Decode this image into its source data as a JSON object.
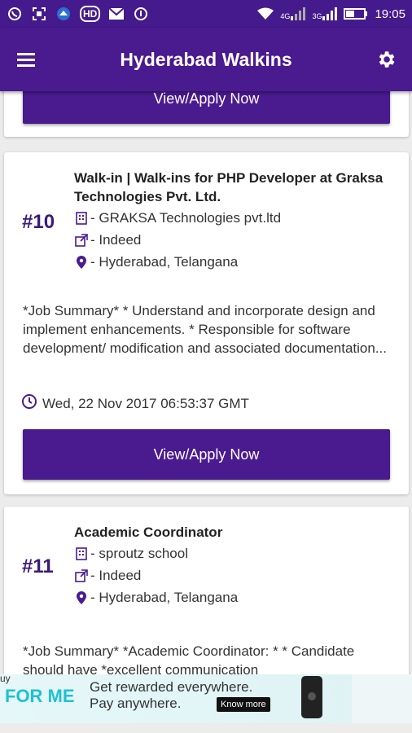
{
  "status_bar": {
    "time": "19:05",
    "icons": [
      "whatsapp-icon",
      "scan-icon",
      "cloud-icon",
      "hd-icon",
      "mail-icon",
      "info-icon",
      "wifi-icon",
      "signal-4g-icon",
      "signal-3g-icon",
      "battery-icon"
    ],
    "hd_label": "HD",
    "net1": "4G",
    "net2": "3G"
  },
  "app_bar": {
    "title": "Hyderabad Walkins",
    "menu_icon": "menu-icon",
    "settings_icon": "gear-icon"
  },
  "jobs": [
    {
      "button_label": "View/Apply Now"
    },
    {
      "number": "#10",
      "title": "Walk-in | Walk-ins for PHP Developer at Graksa Technologies Pvt. Ltd.",
      "company": "- GRAKSA Technologies pvt.ltd",
      "source": "- Indeed",
      "location": "- Hyderabad, Telangana",
      "summary": "*Job Summary* * Understand and incorporate design and implement enhancements. * Responsible for software development/ modification and associated documentation...",
      "date": "Wed, 22 Nov 2017 06:53:37 GMT",
      "button_label": "View/Apply Now"
    },
    {
      "number": "#11",
      "title": "Academic Coordinator",
      "company": "- sproutz school",
      "source": "- Indeed",
      "location": "- Hyderabad, Telangana",
      "summary": "*Job Summary* *Academic Coordinator: * * Candidate should have *excellent communication"
    }
  ],
  "ad": {
    "prefix": "uy",
    "brand": "FOR ME",
    "line1": "Get rewarded everywhere.",
    "line2": "Pay anywhere.",
    "cta": "Know more"
  },
  "colors": {
    "primary": "#4a1a8f",
    "status_bar": "#451a8c",
    "number": "#3a1a7a",
    "ad_brand": "#1ec1d2"
  }
}
